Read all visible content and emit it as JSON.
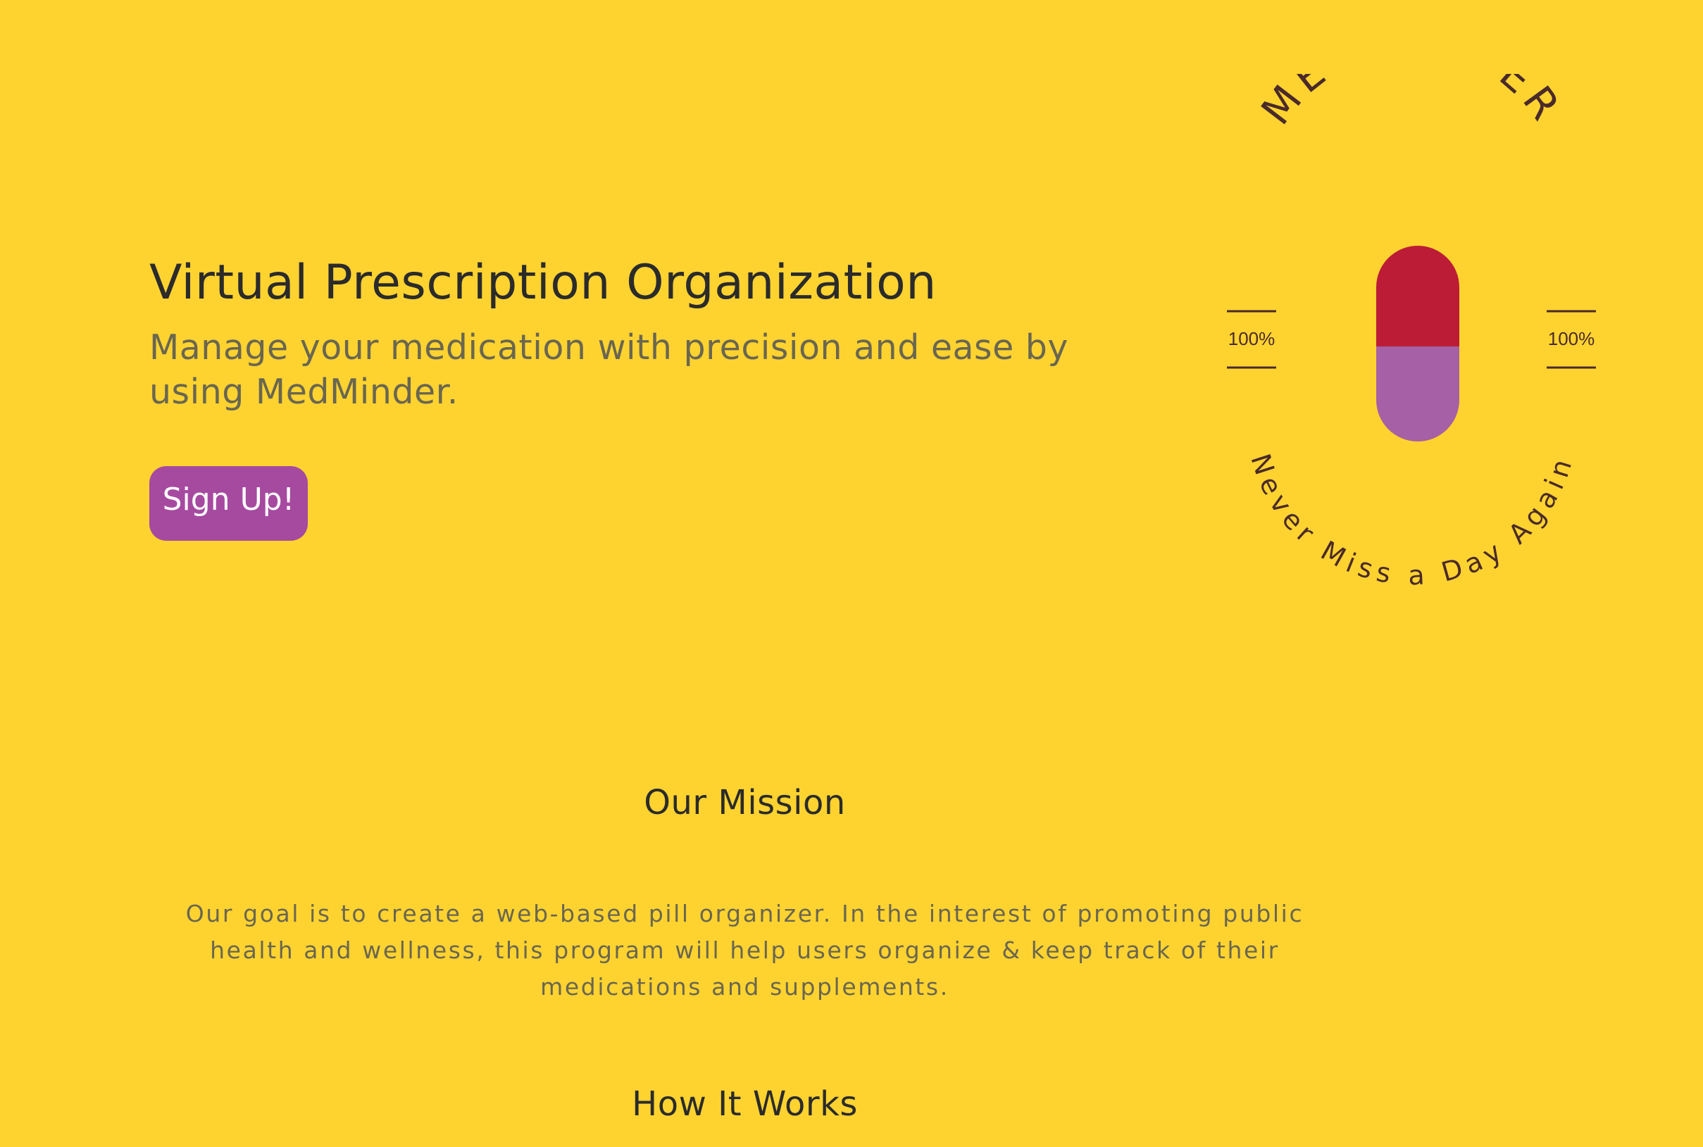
{
  "colors": {
    "background": "#FED330",
    "accent": "#A64AA0",
    "pill_top": "#BC1C36",
    "pill_bottom": "#A660A5",
    "logo_text": "#4a2a2a",
    "heading": "#2b2b2b",
    "body_text": "#6a6650"
  },
  "hero": {
    "title": "Virtual Prescription Organization",
    "subtitle": "Manage your medication with precision and ease by using MedMinder.",
    "signup_label": "Sign Up!"
  },
  "logo": {
    "brand": "MEDMINDER",
    "tagline": "Never Miss a Day Again",
    "left_percent": "100%",
    "right_percent": "100%",
    "icon": "pill-icon"
  },
  "mission": {
    "heading": "Our Mission",
    "text": "Our goal is to create a web-based pill organizer. In the interest of promoting public health and wellness, this program will help users organize & keep track of their medications and supplements."
  },
  "how_it_works": {
    "heading": "How It Works"
  }
}
